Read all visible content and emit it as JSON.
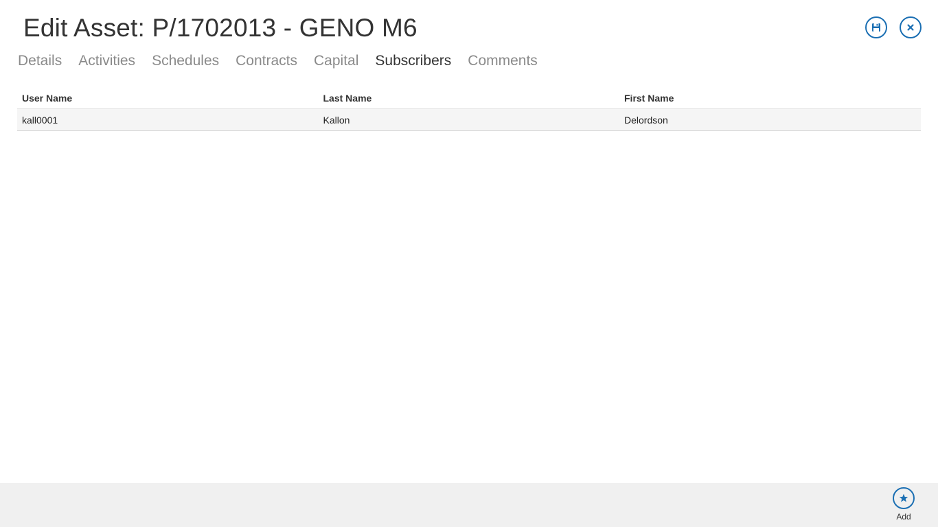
{
  "header": {
    "title": "Edit Asset: P/1702013 - GENO M6",
    "save_icon": "save-icon",
    "close_icon": "close-icon"
  },
  "tabs": [
    {
      "label": "Details",
      "active": false
    },
    {
      "label": "Activities",
      "active": false
    },
    {
      "label": "Schedules",
      "active": false
    },
    {
      "label": "Contracts",
      "active": false
    },
    {
      "label": "Capital",
      "active": false
    },
    {
      "label": "Subscribers",
      "active": true
    },
    {
      "label": "Comments",
      "active": false
    }
  ],
  "grid": {
    "columns": [
      "User Name",
      "Last Name",
      "First Name"
    ],
    "rows": [
      [
        "kall0001",
        "Kallon",
        "Delordson"
      ]
    ]
  },
  "app_bar": {
    "add_label": "Add",
    "add_icon": "star-icon"
  },
  "colors": {
    "accent": "#1b6fb3",
    "app_bar_bg": "#f0f0f0",
    "row_bg": "#f5f5f5"
  }
}
